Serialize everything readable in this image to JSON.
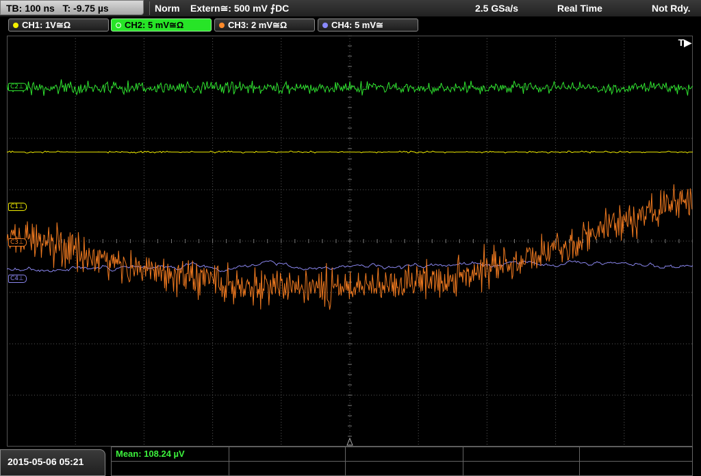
{
  "status_bar": {
    "timebase": "TB: 100 ns",
    "trigger_time": "T: -9.75 µs",
    "acq_mode": "Norm",
    "trigger_source": "Extern≅: 500 mV ⨍DC",
    "sample_rate": "2.5 GSa/s",
    "realtime": "Real Time",
    "state": "Not Rdy."
  },
  "channels": [
    {
      "label": "CH1: 1V≅Ω",
      "color": "#f4f000",
      "active": false
    },
    {
      "label": "CH2: 5 mV≅Ω",
      "color": "#27e427",
      "active": true
    },
    {
      "label": "CH3: 2 mV≅Ω",
      "color": "#ff8a2a",
      "active": false
    },
    {
      "label": "CH4: 5 mV≅",
      "color": "#8a8aff",
      "active": false
    }
  ],
  "markers": {
    "c1": "C1⊥",
    "c2": "C2⊥",
    "c3": "C3⊥",
    "c4": "C4⊥",
    "trigger": "T▶"
  },
  "colors": {
    "ch1": "#f4f000",
    "ch2": "#2fe42f",
    "ch3": "#f07a20",
    "ch4": "#8a86ee",
    "grid": "#5a5a5a"
  },
  "bottom": {
    "timestamp": "2015-05-06 05:21",
    "measurement": "Mean: 108.24 µV"
  }
}
